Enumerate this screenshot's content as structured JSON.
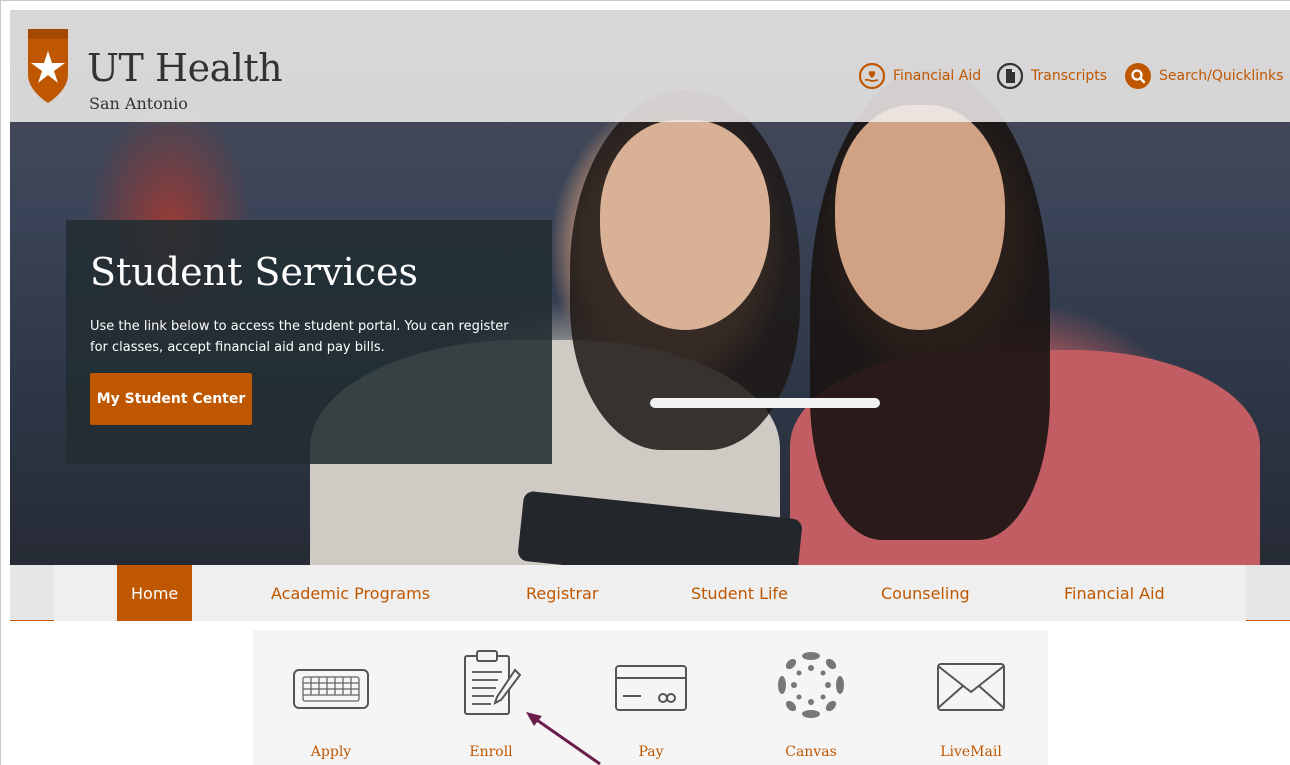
{
  "header": {
    "logo_title": "UT Health",
    "logo_subtitle": "San Antonio",
    "links": [
      {
        "label": "Financial Aid",
        "icon": "heart-hand-icon"
      },
      {
        "label": "Transcripts",
        "icon": "document-icon"
      },
      {
        "label": "Search/Quicklinks",
        "icon": "search-icon"
      }
    ]
  },
  "hero": {
    "title": "Student Services",
    "description": "Use the link below to access the student portal. You can register for classes, accept financial aid and pay bills.",
    "cta_label": "My Student Center"
  },
  "nav": {
    "items": [
      {
        "label": "Home",
        "active": true
      },
      {
        "label": "Academic Programs"
      },
      {
        "label": "Registrar"
      },
      {
        "label": "Student Life"
      },
      {
        "label": "Counseling"
      },
      {
        "label": "Financial Aid"
      }
    ]
  },
  "quicklinks": {
    "items": [
      {
        "label": "Apply",
        "icon": "keyboard-icon"
      },
      {
        "label": "Enroll",
        "icon": "clipboard-icon"
      },
      {
        "label": "Pay",
        "icon": "credit-card-icon"
      },
      {
        "label": "Canvas",
        "icon": "canvas-icon"
      },
      {
        "label": "LiveMail",
        "icon": "envelope-icon"
      }
    ]
  },
  "colors": {
    "accent": "#bf5700",
    "promo_bg": "#212d32"
  }
}
